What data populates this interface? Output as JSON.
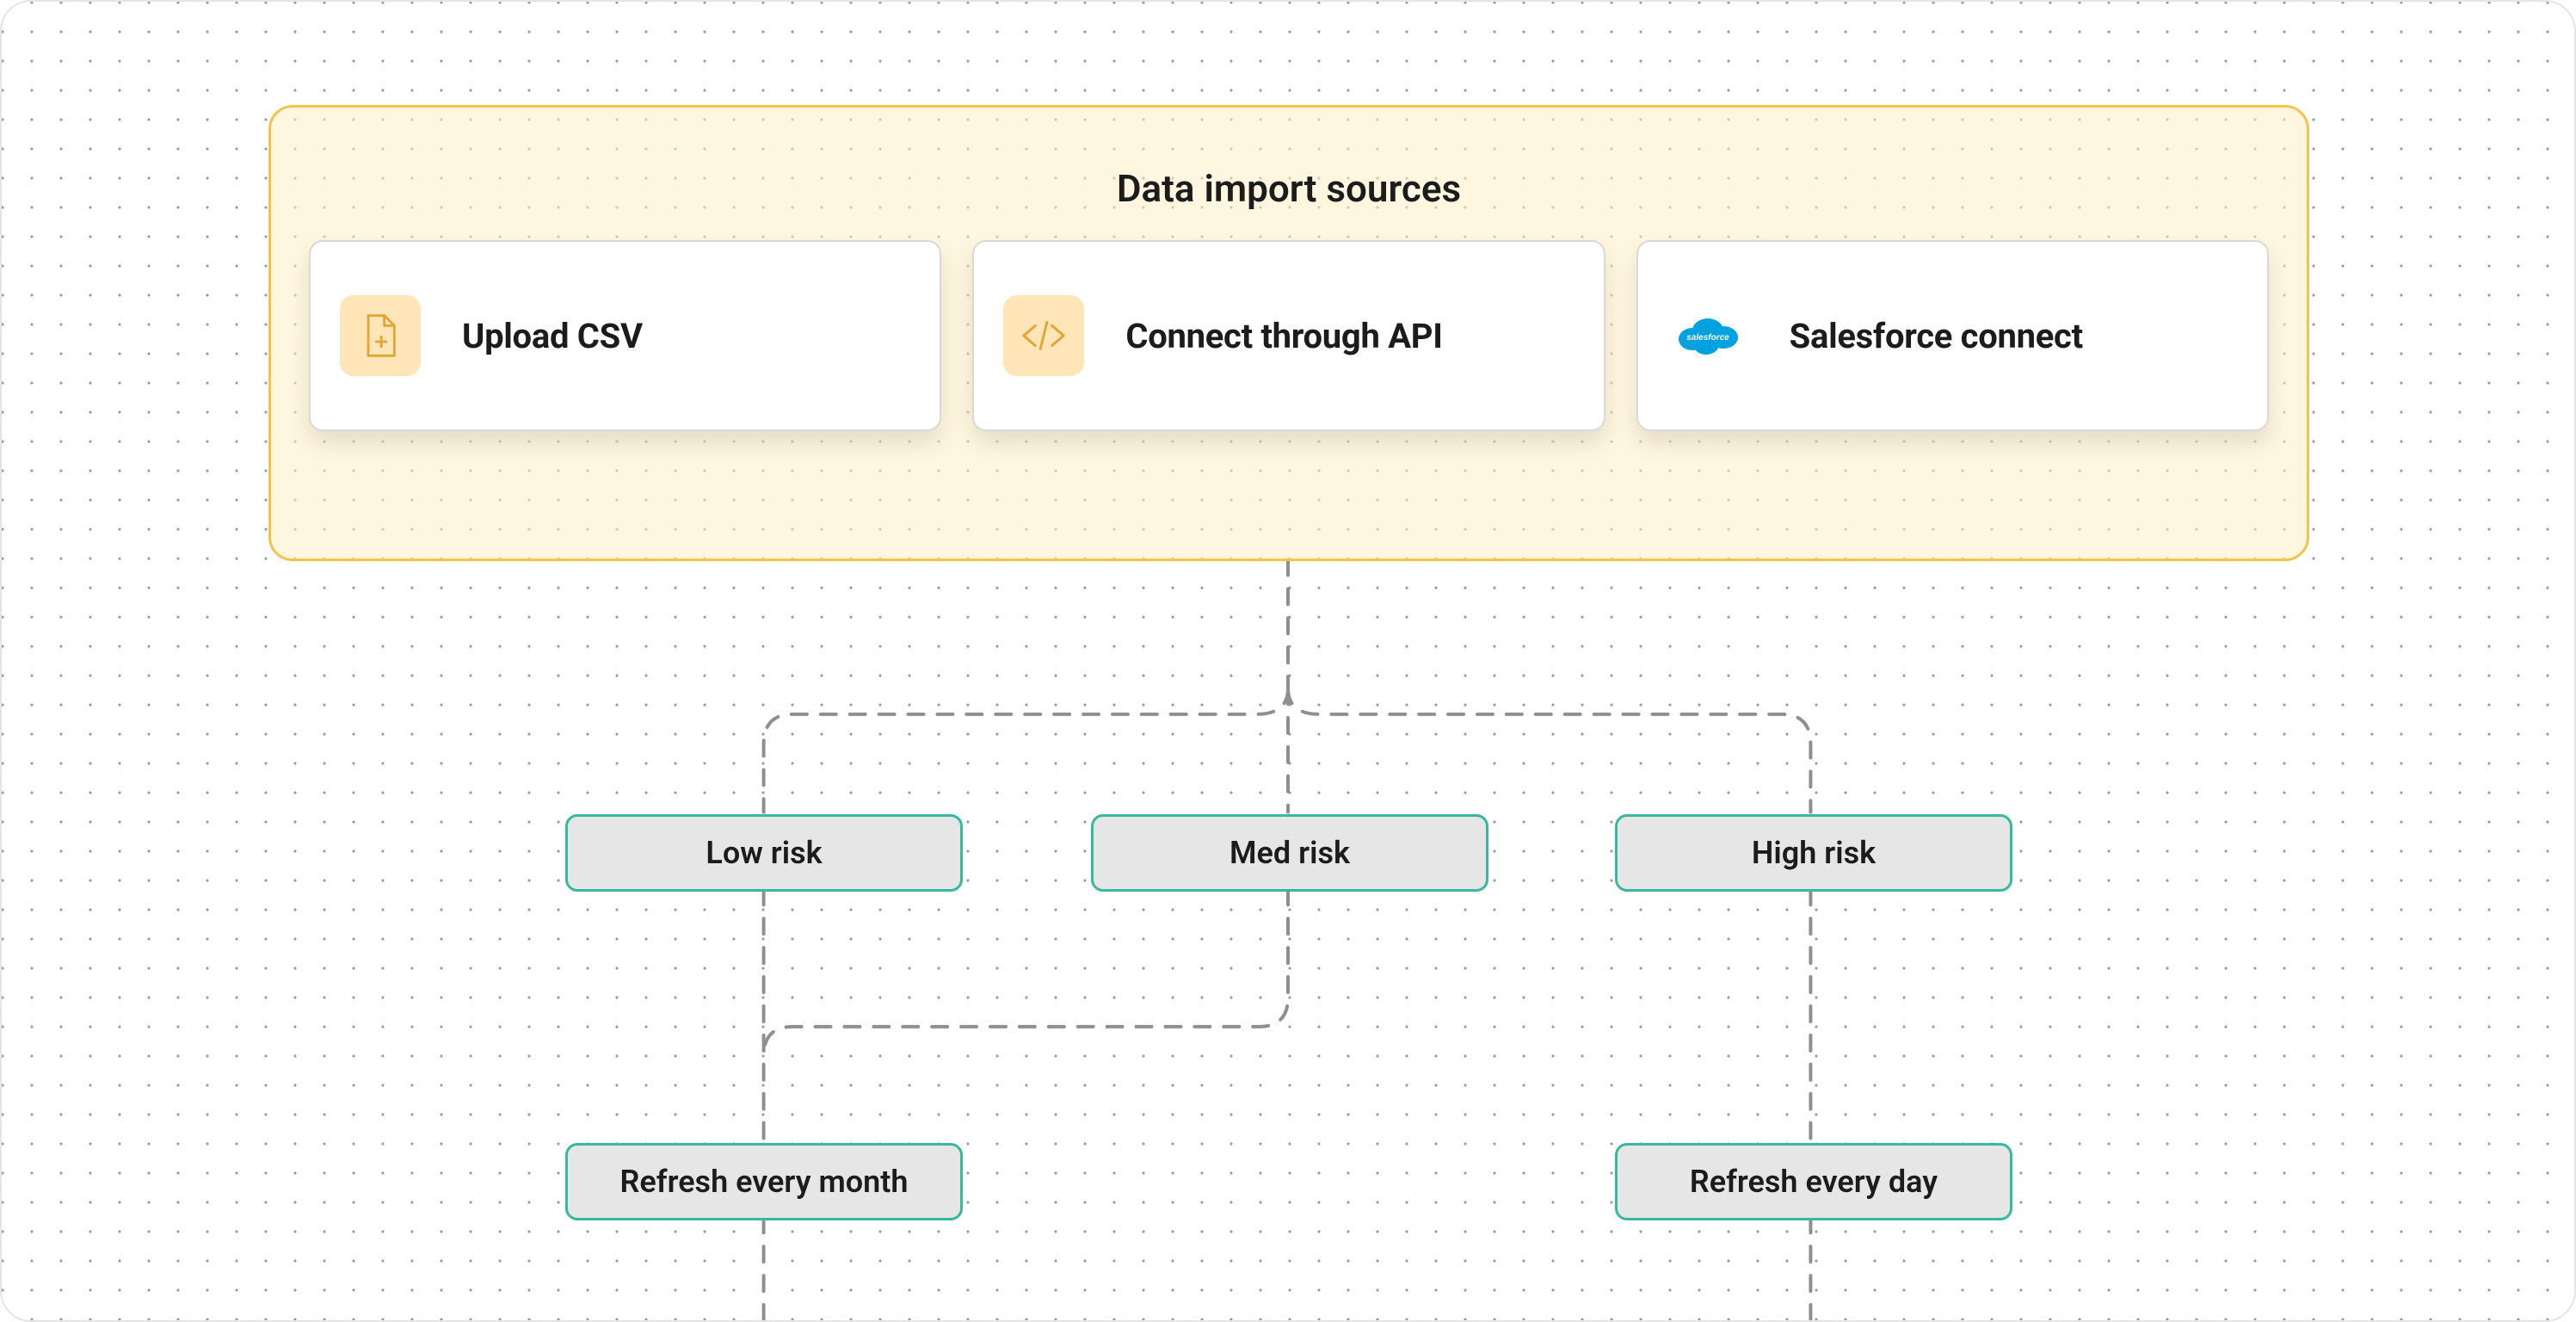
{
  "panel": {
    "title": "Data import sources",
    "sources": [
      {
        "label": "Upload CSV",
        "icon": "file-add-icon"
      },
      {
        "label": "Connect through API",
        "icon": "code-icon"
      },
      {
        "label": "Salesforce connect",
        "icon": "salesforce-icon"
      }
    ]
  },
  "risk": {
    "low": "Low risk",
    "med": "Med risk",
    "high": "High risk"
  },
  "refresh": {
    "month": "Refresh every month",
    "day": "Refresh every day"
  },
  "colors": {
    "panel_bg": "#fff5dd",
    "panel_border": "#f3c44d",
    "pill_border": "#37b8a0",
    "pill_bg": "#e6e6e6",
    "connector": "#8f8f8f"
  }
}
